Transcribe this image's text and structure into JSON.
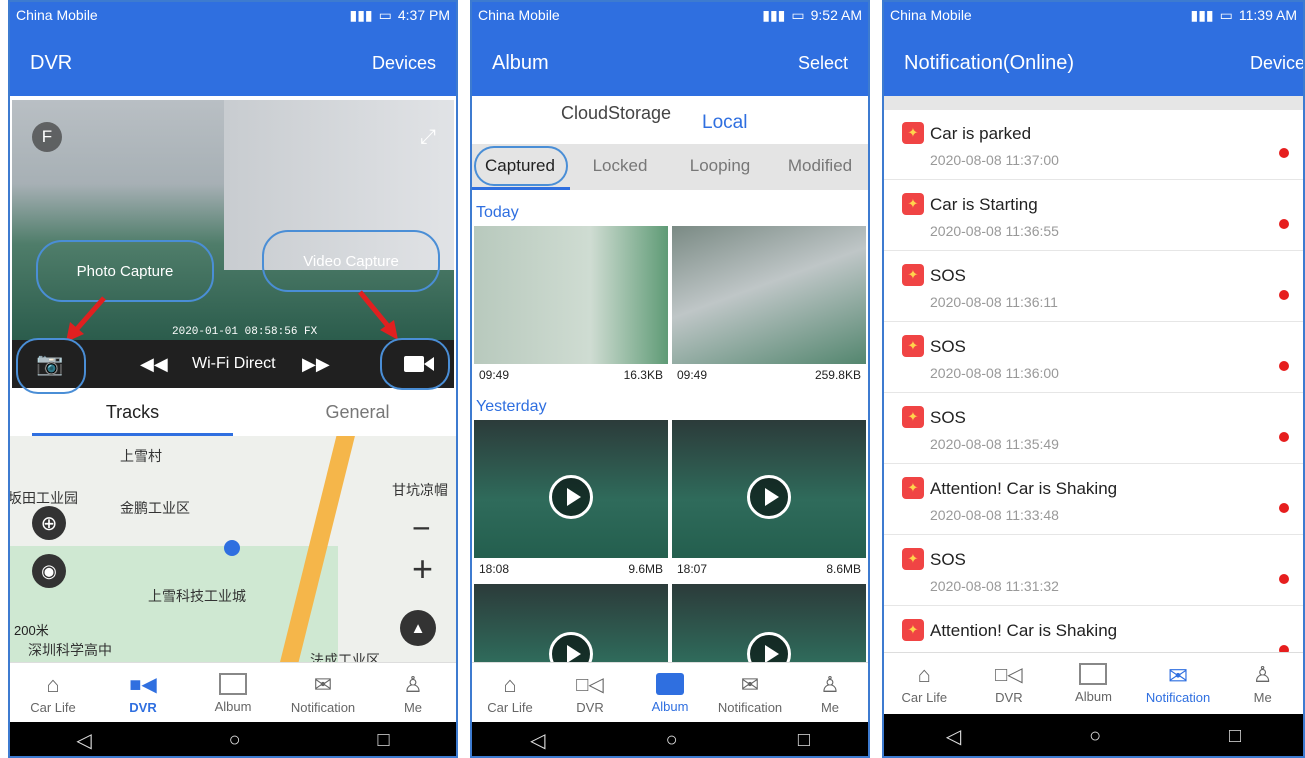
{
  "colors": {
    "primary": "#2f6fe0",
    "callout": "#4a8ed6",
    "unread": "#e61e1e"
  },
  "dvr": {
    "status": {
      "carrier": "China Mobile",
      "time": "4:37 PM"
    },
    "title": "DVR",
    "action": "Devices",
    "video": {
      "channel_badge": "F",
      "timestamp": "2020-01-01 08:58:56 FX",
      "fullscreen_icon": "expand-icon"
    },
    "callouts": {
      "photo": "Photo Capture",
      "video": "Video Capture"
    },
    "controls": {
      "mode_label": "Wi-Fi Direct"
    },
    "tabs": [
      "Tracks",
      "General"
    ],
    "map": {
      "labels": [
        "上雪村",
        "坂田工业园",
        "金鹏工业区",
        "甘坑凉帽",
        "上雪科技工业城",
        "深圳科学高中",
        "法成工业区"
      ],
      "scale": "200米",
      "zoom_out": "−",
      "zoom_in": "+"
    },
    "nav": [
      "Car Life",
      "DVR",
      "Album",
      "Notification",
      "Me"
    ]
  },
  "album": {
    "status": {
      "carrier": "China Mobile",
      "time": "9:52 AM"
    },
    "title": "Album",
    "action": "Select",
    "storage_tabs": [
      "CloudStorage",
      "Local"
    ],
    "filter_tabs": [
      "Captured",
      "Locked",
      "Looping",
      "Modified"
    ],
    "sections": {
      "today": {
        "label": "Today",
        "items": [
          {
            "time": "09:49",
            "size": "16.3KB"
          },
          {
            "time": "09:49",
            "size": "259.8KB"
          }
        ]
      },
      "yesterday": {
        "label": "Yesterday",
        "items": [
          {
            "time": "18:08",
            "size": "9.6MB"
          },
          {
            "time": "18:07",
            "size": "8.6MB"
          }
        ]
      }
    },
    "nav": [
      "Car Life",
      "DVR",
      "Album",
      "Notification",
      "Me"
    ]
  },
  "notification": {
    "status": {
      "carrier": "China Mobile",
      "time": "11:39 AM"
    },
    "title": "Notification(Online)",
    "action": "Device",
    "items": [
      {
        "title": "Car is parked",
        "time": "2020-08-08 11:37:00"
      },
      {
        "title": "Car is Starting",
        "time": "2020-08-08 11:36:55"
      },
      {
        "title": "SOS",
        "time": "2020-08-08 11:36:11"
      },
      {
        "title": "SOS",
        "time": "2020-08-08 11:36:00"
      },
      {
        "title": "SOS",
        "time": "2020-08-08 11:35:49"
      },
      {
        "title": "Attention! Car is Shaking",
        "time": "2020-08-08 11:33:48"
      },
      {
        "title": "SOS",
        "time": "2020-08-08 11:31:32"
      },
      {
        "title": "Attention! Car is Shaking",
        "time": ""
      }
    ],
    "nav": [
      "Car Life",
      "DVR",
      "Album",
      "Notification",
      "Me"
    ]
  }
}
